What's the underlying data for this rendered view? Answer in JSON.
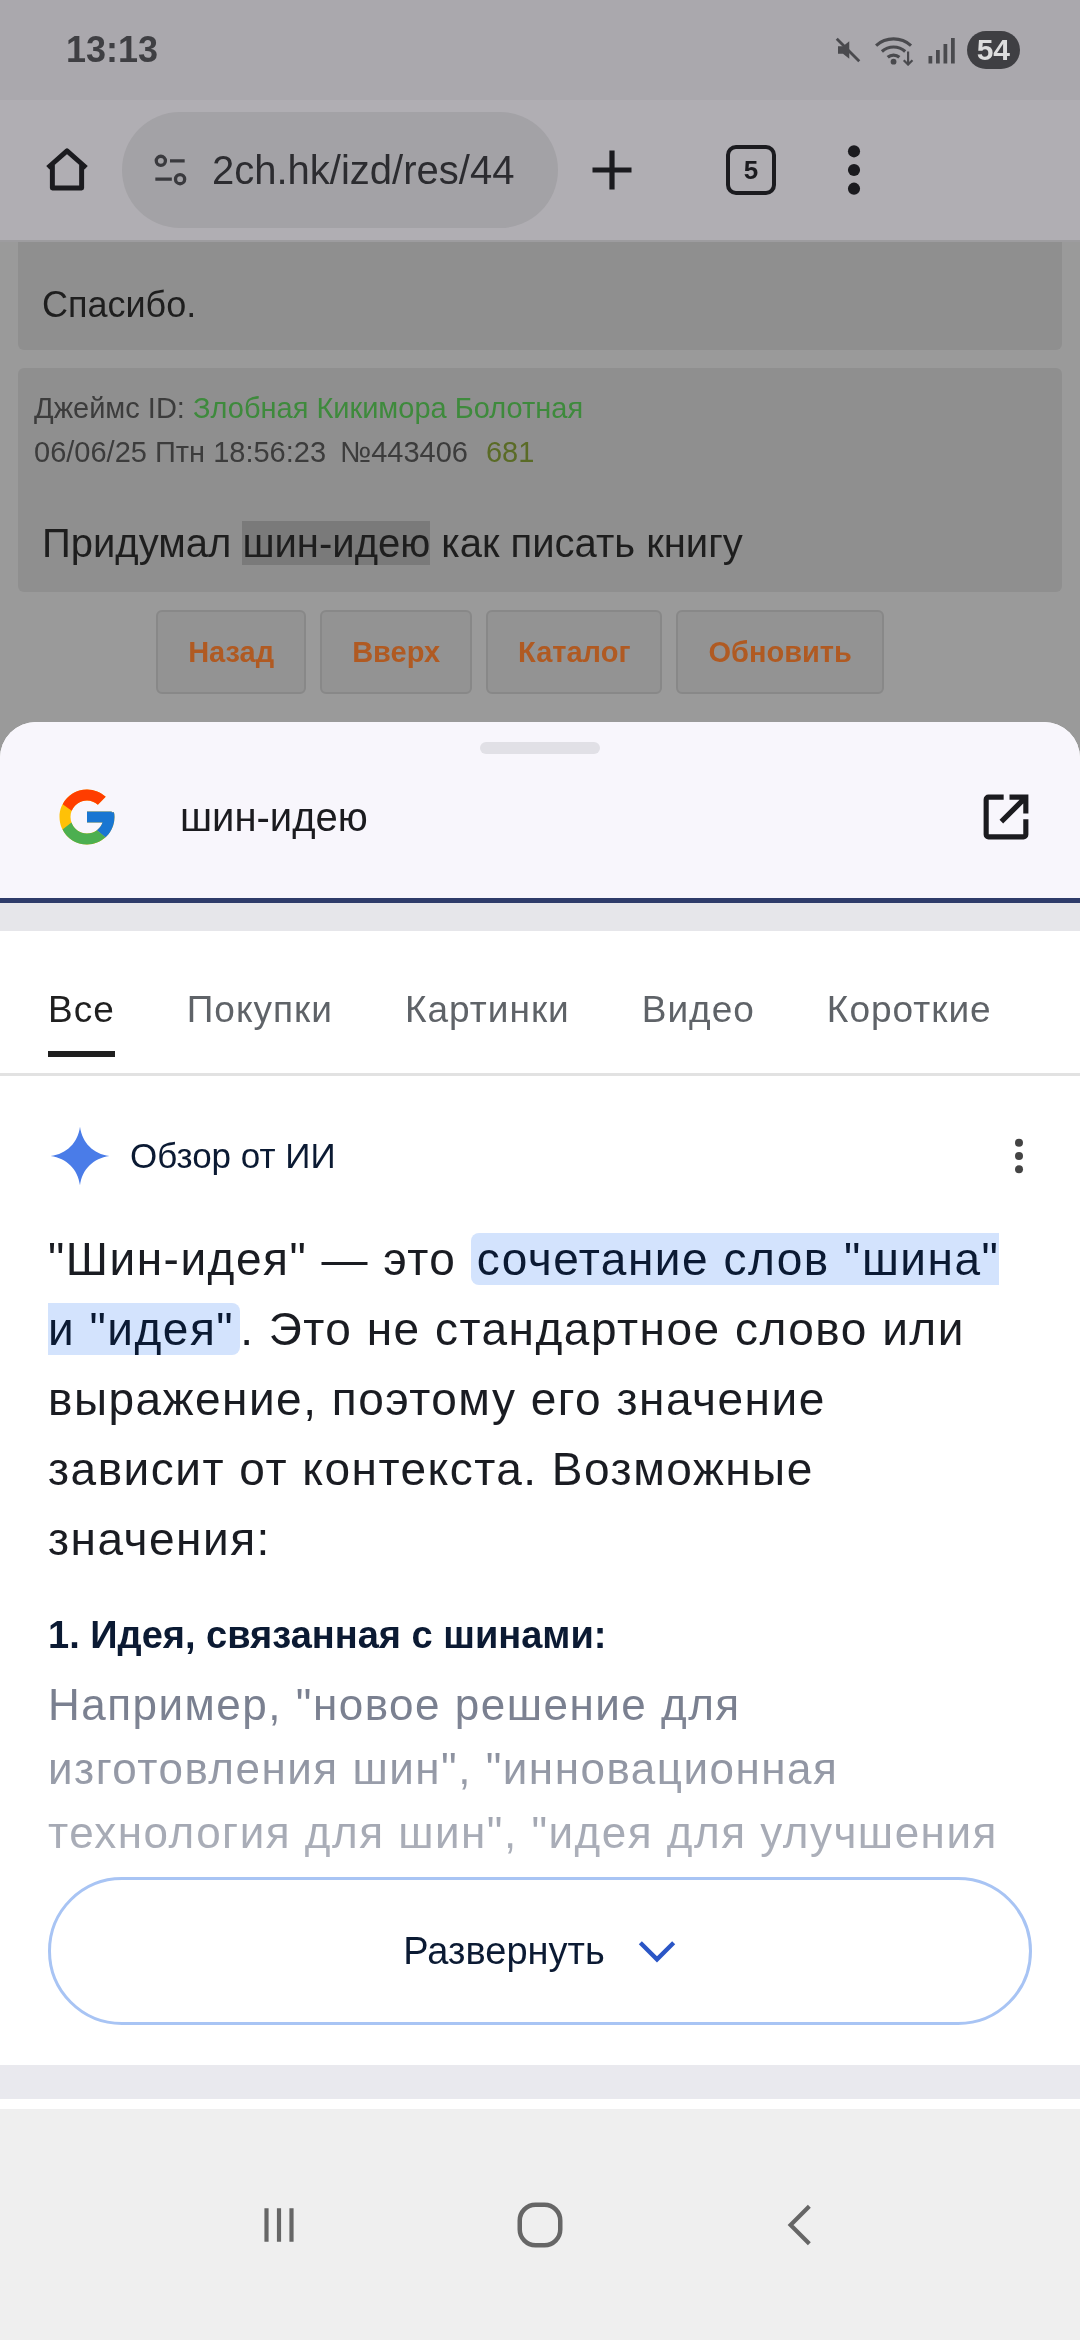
{
  "status_bar": {
    "time": "13:13",
    "battery": "54"
  },
  "browser": {
    "url": "2ch.hk/izd/res/44",
    "tab_count": "5"
  },
  "posts": [
    {
      "body": "Спасибо."
    },
    {
      "author_label": "Джеймс ID: ",
      "author_id": "Злобная Кикимора Болотная",
      "date": "06/06/25 Птн 18:56:23",
      "number": "№443406",
      "reply_count": "681",
      "body_parts": [
        {
          "text": "Придумал ",
          "highlight": false
        },
        {
          "text": "шин-идею",
          "highlight": true
        },
        {
          "text": " как писать книгу",
          "highlight": false
        }
      ]
    }
  ],
  "thread_buttons": [
    "Назад",
    "Вверх",
    "Каталог",
    "Обновить"
  ],
  "sheet": {
    "query": "шин-идею",
    "tabs": [
      {
        "label": "Все",
        "selected": true
      },
      {
        "label": "Покупки",
        "selected": false
      },
      {
        "label": "Картинки",
        "selected": false
      },
      {
        "label": "Видео",
        "selected": false
      },
      {
        "label": "Короткие",
        "selected": false
      }
    ],
    "ai_overview": {
      "title": "Обзор от ИИ",
      "paragraph": [
        {
          "text": "\"Шин-идея\" — это ",
          "highlight": false
        },
        {
          "text": "сочетание слов \"шина\" и \"идея\"",
          "highlight": true
        },
        {
          "text": ". Это не стандартное слово или выражение, поэтому его значение зависит от контекста. Возможные значения:",
          "highlight": false
        }
      ],
      "heading": "1. Идея, связанная с шинами:",
      "faded_text": "Например, \"новое решение для изготовления шин\", \"инновационная технология для шин\", \"идея для улучшения",
      "expand_button": "Развернуть"
    }
  }
}
